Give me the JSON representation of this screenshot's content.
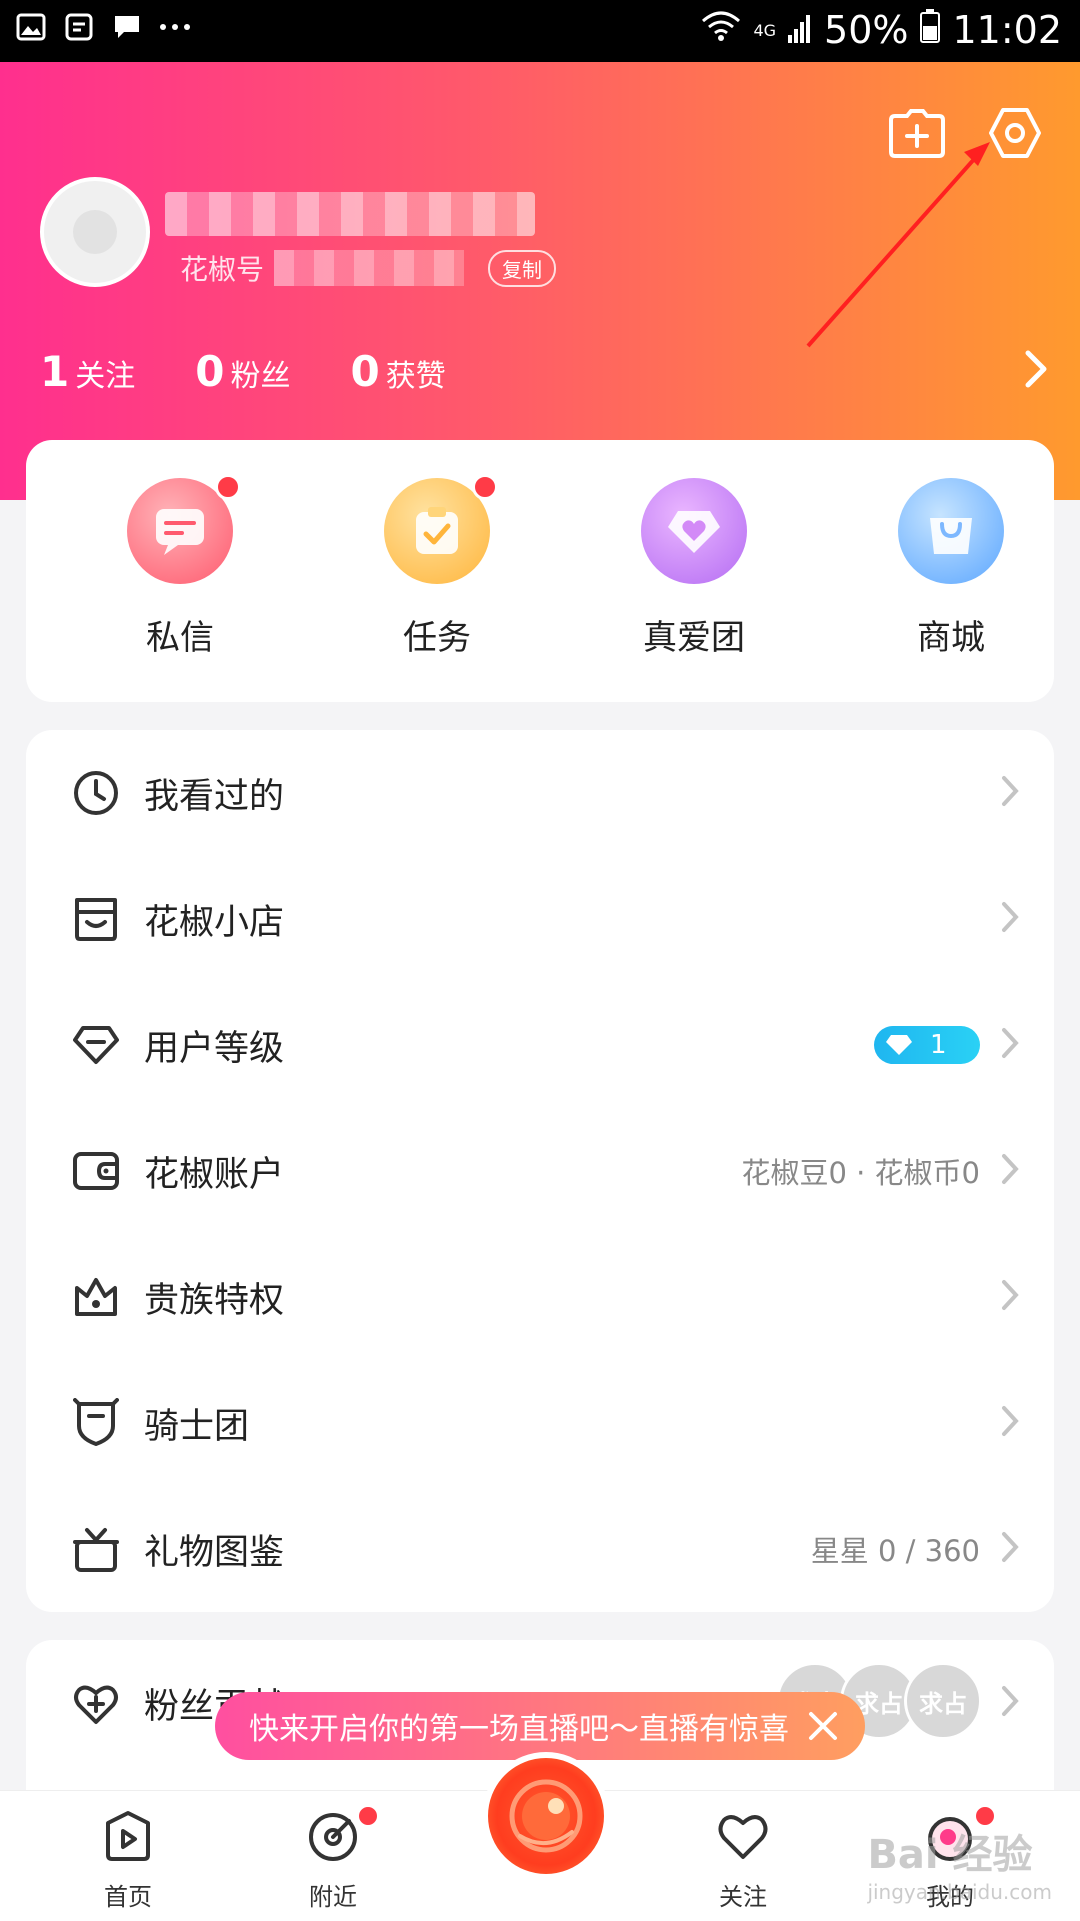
{
  "status_bar": {
    "icons": [
      "image-icon",
      "app-icon",
      "message-icon",
      "more-dots-icon"
    ],
    "network": "4G",
    "battery": "50%",
    "time": "11:02"
  },
  "header": {
    "id_label": "花椒号",
    "copy_label": "复制",
    "stats": [
      {
        "count": "1",
        "label": "关注"
      },
      {
        "count": "0",
        "label": "粉丝"
      },
      {
        "count": "0",
        "label": "获赞"
      }
    ]
  },
  "quick_actions": [
    {
      "label": "私信",
      "color": "#ff5a6e",
      "badge": true
    },
    {
      "label": "任务",
      "color": "#ffb53b",
      "badge": true
    },
    {
      "label": "真爱团",
      "color": "#b46cf3",
      "badge": false
    },
    {
      "label": "商城",
      "color": "#5ba6ff",
      "badge": false
    }
  ],
  "menu": [
    {
      "label": "我看过的",
      "icon": "clock-icon",
      "value": ""
    },
    {
      "label": "花椒小店",
      "icon": "shop-icon",
      "value": ""
    },
    {
      "label": "用户等级",
      "icon": "diamond-icon",
      "value": "",
      "level": "1"
    },
    {
      "label": "花椒账户",
      "icon": "wallet-icon",
      "value": "花椒豆0 · 花椒币0"
    },
    {
      "label": "贵族特权",
      "icon": "crown-icon",
      "value": ""
    },
    {
      "label": "骑士团",
      "icon": "shield-icon",
      "value": ""
    },
    {
      "label": "礼物图鉴",
      "icon": "gift-icon",
      "value": "星星 0 / 360"
    }
  ],
  "fan_row": {
    "label": "粉丝贡献",
    "coins": [
      "求占",
      "求占",
      "求占"
    ]
  },
  "toast": {
    "text": "快来开启你的第一场直播吧～直播有惊喜"
  },
  "tabbar": [
    {
      "label": "首页",
      "icon": "home-play-icon"
    },
    {
      "label": "附近",
      "icon": "nearby-radar-icon",
      "badge": true
    },
    {
      "label": "",
      "icon": "live-camera-icon"
    },
    {
      "label": "关注",
      "icon": "heart-icon"
    },
    {
      "label": "我的",
      "icon": "profile-icon",
      "badge": true
    }
  ],
  "watermark": {
    "text": "Bai 经验",
    "sub": "jingyan.baidu.com"
  },
  "colors": {
    "accent_pink": "#ff2f8e",
    "accent_orange": "#ff9a2e",
    "badge_red": "#ff3b47"
  }
}
